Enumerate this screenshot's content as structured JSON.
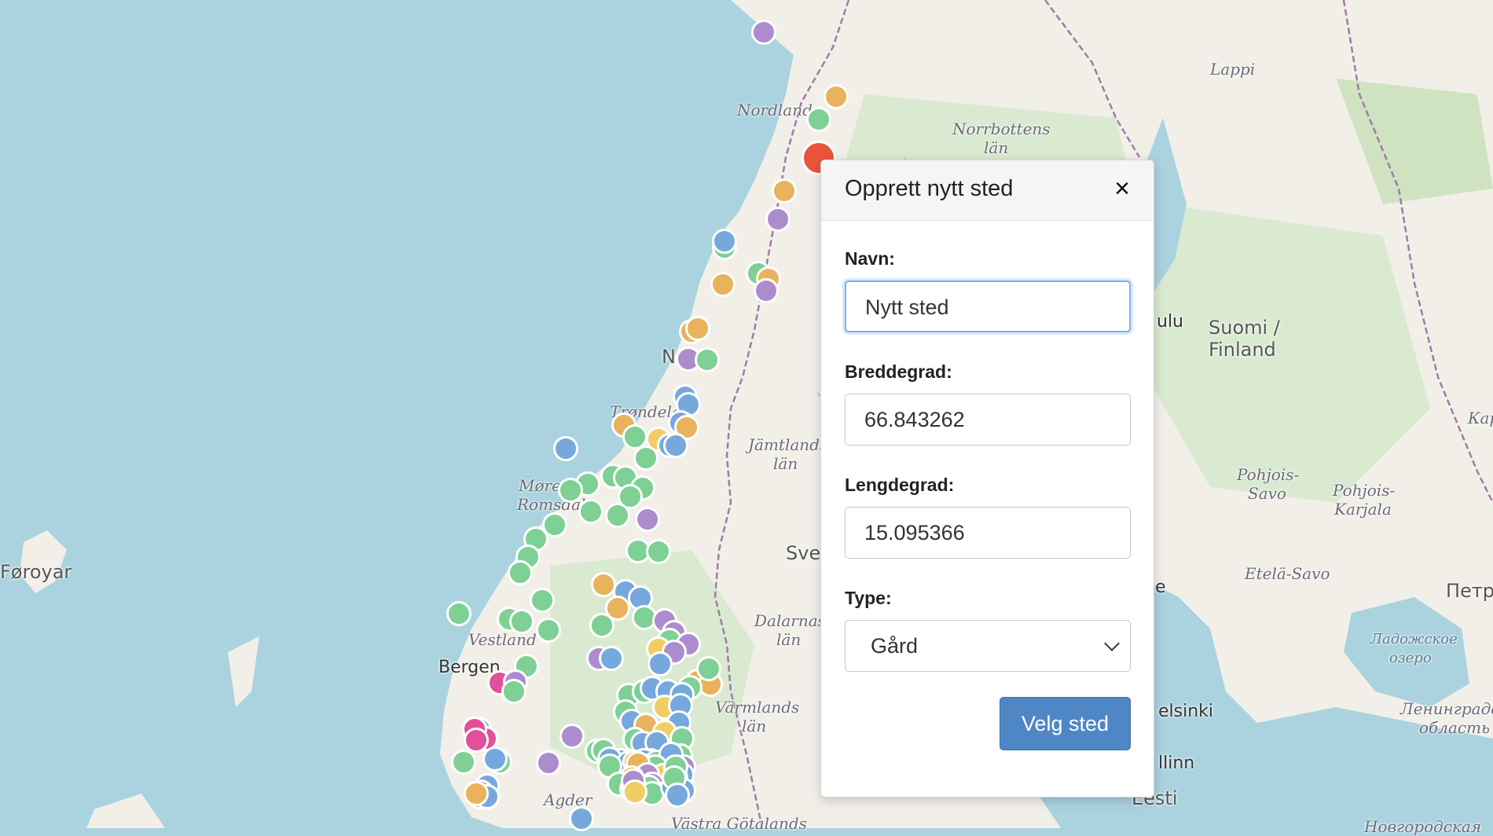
{
  "map": {
    "colors": {
      "sea": "#aad3df",
      "land": "#f2efe9",
      "forest": "#d4e7c5",
      "border": "#a07ba8",
      "green": "#7ed094",
      "orange": "#e9b25c",
      "purple": "#ad8cce",
      "blue": "#76a8dd",
      "yellow": "#f1cd64",
      "pink": "#e24f9a",
      "red": "#e9553b"
    },
    "labels": {
      "lappi": "Lappi",
      "nordland": "Nordland",
      "norrbottens": "Norrbottens",
      "lan1": "län",
      "suomi": "Suomi /",
      "finland": "Finland",
      "oulu": "ulu",
      "karel": "Карел",
      "norge": "N",
      "trondelag": "Trøndelag",
      "jamtlands": "Jämtlands",
      "lan2": "län",
      "more": "Møre",
      "romsdal": "Romsdal",
      "pohjois_savo": "Pohjois-",
      "savo": "Savo",
      "pohjois_karjala": "Pohjois-",
      "karjala": "Karjala",
      "foroyar": "Føroyar",
      "sve": "Sve",
      "etela_savo": "Etelä-Savo",
      "petro": "Петро",
      "vestland": "Vestland",
      "dalarnas": "Dalarnas",
      "lan3": "län",
      "ladoga1": "Ладожское",
      "ladoga2": "озеро",
      "bergen": "Bergen",
      "varmlands": "Värmlands",
      "lan4": "län",
      "helsinki": "elsinki",
      "leningrad1": "Ленинградс",
      "leningrad2": "область",
      "tallinn": "llinn",
      "agder": "Agder",
      "eesti": "Eesti",
      "vastra": "Västra Götalands",
      "novgorod": "Новгородская",
      "e": "e"
    }
  },
  "modal": {
    "title": "Opprett nytt sted",
    "close": "×",
    "name_label": "Navn:",
    "name_value": "Nytt sted",
    "lat_label": "Breddegrad:",
    "lat_value": "66.843262",
    "lng_label": "Lengdegrad:",
    "lng_value": "15.095366",
    "type_label": "Type:",
    "type_value": "Gård",
    "submit": "Velg sted"
  }
}
